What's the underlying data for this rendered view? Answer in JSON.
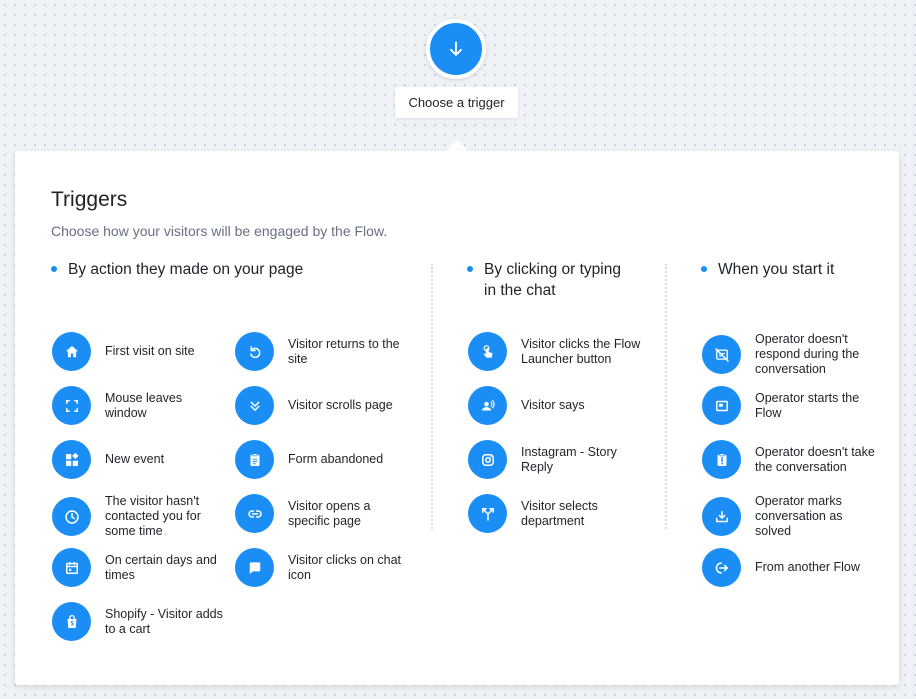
{
  "flow": {
    "start_icon": "arrow-down-icon",
    "trigger_label": "Choose a trigger"
  },
  "panel": {
    "title": "Triggers",
    "subtitle": "Choose how your visitors will be engaged by the Flow."
  },
  "columns": [
    {
      "heading": "By action they made on your page"
    },
    {
      "heading": "By clicking or typing in the chat"
    },
    {
      "heading": "When you start it"
    }
  ],
  "triggers": {
    "page_action_left": [
      {
        "label": "First visit on site",
        "icon": "home-icon"
      },
      {
        "label": "Mouse leaves window",
        "icon": "fullscreen-icon"
      },
      {
        "label": "New event",
        "icon": "widgets-icon"
      },
      {
        "label": "The visitor hasn't contacted you for some time",
        "icon": "clock-icon"
      },
      {
        "label": "On certain days and times",
        "icon": "calendar-icon"
      },
      {
        "label": "Shopify - Visitor adds to a cart",
        "icon": "shopify-bag-icon"
      }
    ],
    "page_action_right": [
      {
        "label": "Visitor returns to the site",
        "icon": "return-icon"
      },
      {
        "label": "Visitor scrolls page",
        "icon": "double-chevron-down-icon"
      },
      {
        "label": "Form abandoned",
        "icon": "clipboard-icon"
      },
      {
        "label": "Visitor opens a specific page",
        "icon": "link-icon"
      },
      {
        "label": "Visitor clicks on chat icon",
        "icon": "chat-bubble-icon"
      }
    ],
    "chat": [
      {
        "label": "Visitor clicks the Flow Launcher button",
        "icon": "tap-icon"
      },
      {
        "label": "Visitor says",
        "icon": "speaking-person-icon"
      },
      {
        "label": "Instagram - Story Reply",
        "icon": "instagram-icon"
      },
      {
        "label": "Visitor selects department",
        "icon": "split-arrows-icon"
      }
    ],
    "operator": [
      {
        "label": "Operator doesn't respond during the conversation",
        "icon": "no-message-icon"
      },
      {
        "label": "Operator starts the Flow",
        "icon": "window-icon"
      },
      {
        "label": "Operator doesn't take the conversation",
        "icon": "alert-clipboard-icon"
      },
      {
        "label": "Operator marks conversation as solved",
        "icon": "tray-download-icon"
      },
      {
        "label": "From another Flow",
        "icon": "flow-exit-icon"
      }
    ]
  },
  "colors": {
    "accent": "#1b8ef5",
    "text": "#1f2229",
    "muted": "#677183",
    "background": "#eef1f5"
  }
}
